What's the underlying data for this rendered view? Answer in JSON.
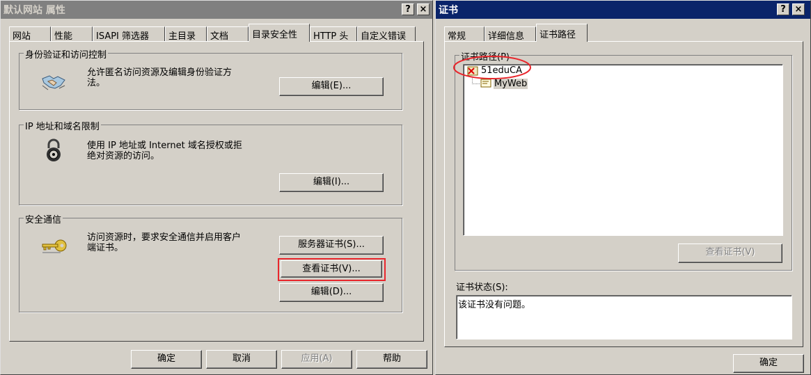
{
  "props": {
    "title": "默认网站 属性",
    "help_btn": "?",
    "close_btn": "×",
    "tabs": [
      "网站",
      "性能",
      "ISAPI 筛选器",
      "主目录",
      "文档",
      "目录安全性",
      "HTTP 头",
      "自定义错误"
    ],
    "auth": {
      "label": "身份验证和访问控制",
      "desc1": "允许匿名访问资源及编辑身份验证方",
      "desc2": "法。",
      "edit": "编辑(E)..."
    },
    "ip": {
      "label": "IP 地址和域名限制",
      "desc1": "使用 IP 地址或 Internet 域名授权或拒",
      "desc2": "绝对资源的访问。",
      "edit": "编辑(I)..."
    },
    "secure": {
      "label": "安全通信",
      "desc1": "访问资源时，要求安全通信并启用客户",
      "desc2": "端证书。",
      "server_cert": "服务器证书(S)...",
      "view_cert": "查看证书(V)...",
      "edit": "编辑(D)..."
    },
    "ok": "确定",
    "cancel": "取消",
    "apply": "应用(A)",
    "help": "帮助"
  },
  "cert": {
    "title": "证书",
    "help_btn": "?",
    "close_btn": "×",
    "tabs": [
      "常规",
      "详细信息",
      "证书路径"
    ],
    "path_label": "证书路径(P)",
    "tree": [
      "51eduCA",
      "MyWeb"
    ],
    "view_cert": "查看证书(V)",
    "status_label": "证书状态(S):",
    "status_text": "该证书没有问题。",
    "ok": "确定"
  },
  "colors": {
    "highlight_red": "#e8262c",
    "title_active": "#0a246a",
    "title_inactive": "#808080"
  }
}
